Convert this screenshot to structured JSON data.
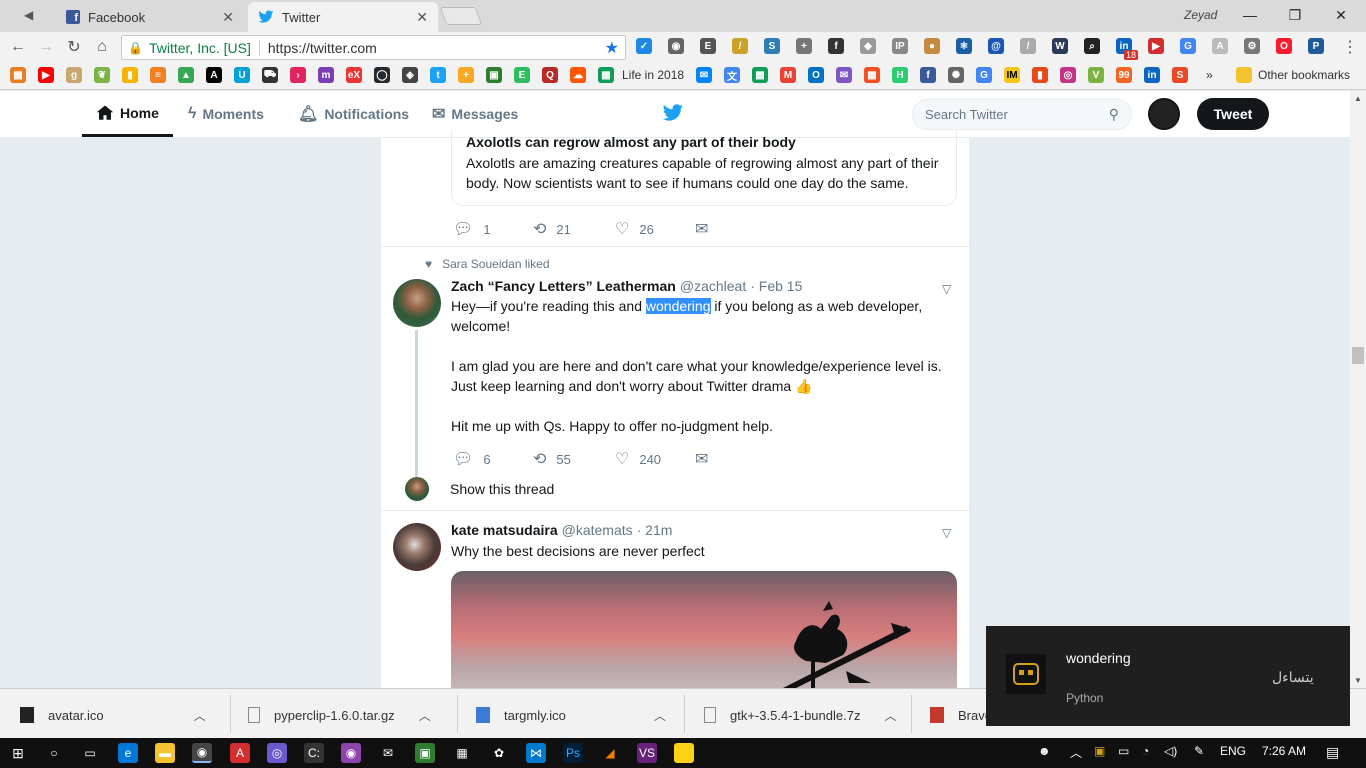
{
  "browser": {
    "tabs": [
      {
        "label": "Facebook"
      },
      {
        "label": "Twitter"
      }
    ],
    "profile": "Zeyad",
    "omnibox": {
      "site": "Twitter, Inc. [US]",
      "url": "https://twitter.com"
    },
    "bookmarks": {
      "life": "Life in 2018",
      "other": "Other bookmarks",
      "more": "»"
    },
    "ext_badge": "18"
  },
  "twitter": {
    "nav": {
      "home": "Home",
      "moments": "Moments",
      "notifications": "Notifications",
      "messages": "Messages"
    },
    "search_placeholder": "Search Twitter",
    "tweet_button": "Tweet",
    "card": {
      "title": "Axolotls can regrow almost any part of their body",
      "desc": "Axolotls are amazing creatures capable of regrowing almost any part of their body. Now scientists want to see if humans could one day do the same."
    },
    "tweet1_counts": {
      "replies": "1",
      "retweets": "21",
      "likes": "26"
    },
    "liked_by": "Sara Soueidan liked",
    "tweet2": {
      "name": "Zach “Fancy Letters” Leatherman",
      "handle": "@zachleat",
      "time": "· Feb 15",
      "line1_pre": "Hey—if you're reading this and ",
      "line1_hl": "wondering",
      "line1_post": " if you belong as a web developer,",
      "line2": "welcome!",
      "line3": "I am glad you are here and don't care what your knowledge/experience level is.",
      "line4": "Just keep learning and don't worry about Twitter drama 👍",
      "line5": "Hit me up with Qs. Happy to offer no-judgment help.",
      "replies": "6",
      "retweets": "55",
      "likes": "240",
      "show_thread": "Show this thread"
    },
    "tweet3": {
      "name": "kate matsudaira",
      "handle": "@katemats",
      "time": "· 21m",
      "text": "Why the best decisions are never perfect"
    }
  },
  "downloads": [
    {
      "name": "avatar.ico"
    },
    {
      "name": "pyperclip-1.6.0.tar.gz"
    },
    {
      "name": "targmly.ico"
    },
    {
      "name": "gtk+-3.5.4-1-bundle.7z"
    },
    {
      "name": "Brave"
    }
  ],
  "notification": {
    "title": "wondering",
    "app": "Python",
    "translation": "يتساءل"
  },
  "taskbar": {
    "lang": "ENG",
    "time": "7:26 AM"
  },
  "colors": {
    "twitter_blue": "#1da1f2",
    "highlight": "#3390ff"
  }
}
